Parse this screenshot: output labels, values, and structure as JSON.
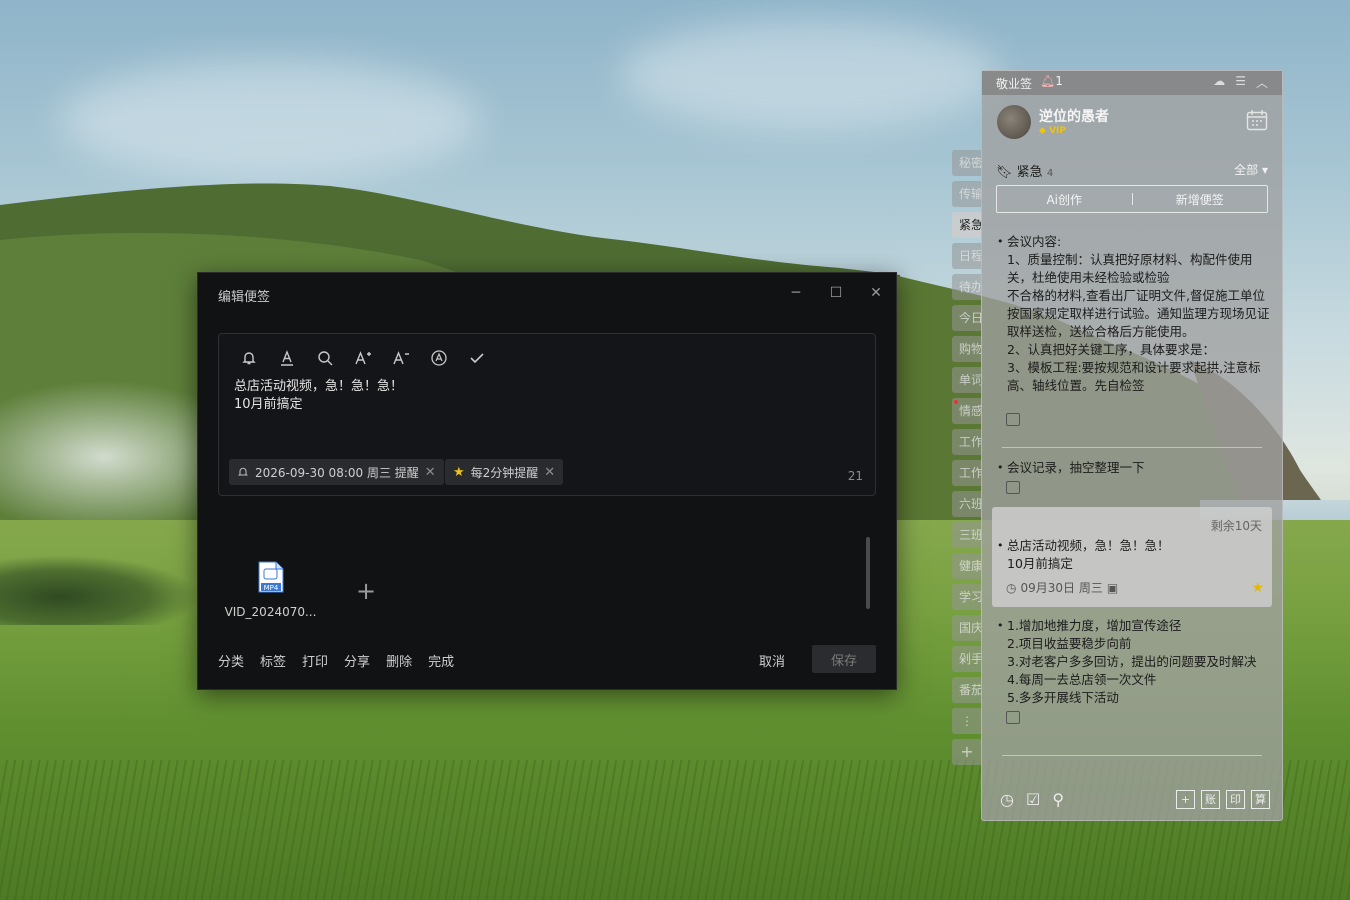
{
  "dialog": {
    "title": "编辑便签",
    "editor_lines": [
      "总店活动视频，急！急！急！",
      "10月前搞定"
    ],
    "reminder_chip": "2026-09-30 08:00 周三 提醒",
    "repeat_chip": "每2分钟提醒",
    "char_count": "21",
    "attachment": {
      "label": "MP4",
      "filename": "VID_2024070..."
    },
    "actions": [
      "分类",
      "标签",
      "打印",
      "分享",
      "删除",
      "完成"
    ],
    "cancel": "取消",
    "save": "保存"
  },
  "side_tabs": [
    "秘密",
    "传输",
    "紧急",
    "日程",
    "待办",
    "今日",
    "购物",
    "单词",
    "情感",
    "工作",
    "工作",
    "六班",
    "三班",
    "健康",
    "学习",
    "国庆",
    "剁手",
    "番茄"
  ],
  "panel": {
    "title": "敬业签",
    "badge": "1",
    "username": "逆位的愚者",
    "vip": "VIP",
    "category": "紧急",
    "category_count": "4",
    "filter": "全部",
    "ai_button": "Ai创作",
    "new_button": "新增便签",
    "notes": [
      {
        "text": "会议内容:\n1、质量控制：认真把好原材料、构配件使用关，杜绝使用未经检验或检验\n不合格的材料,查看出厂证明文件,督促施工单位按国家规定取样进行试验。通知监理方现场见证取样送检，送检合格后方能使用。\n2、认真把好关键工序，具体要求是：\n3、模板工程:要按规范和设计要求起拱,注意标高、轴线位置。先自检签"
      },
      {
        "text": "会议记录，抽空整理一下"
      },
      {
        "remaining": "剩余10天",
        "text": "总店活动视频，急！急！急！\n10月前搞定",
        "date": "09月30日 周三"
      },
      {
        "text": "1.增加地推力度，增加宣传途径\n2.项目收益要稳步向前\n3.对老客户多多回访，提出的问题要及时解决\n4.每周一去总店领一次文件\n5.多多开展线下活动"
      }
    ],
    "bottom_buttons": [
      "+",
      "账",
      "印",
      "算"
    ]
  }
}
